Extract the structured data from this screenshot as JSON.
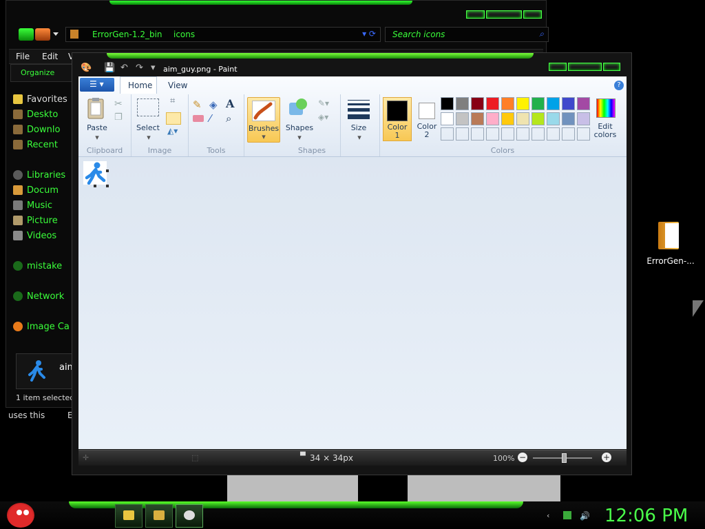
{
  "explorer": {
    "address_crumbs": [
      "ErrorGen-1.2_bin",
      "icons"
    ],
    "search_placeholder": "Search icons",
    "menu": [
      "File",
      "Edit",
      "Vi"
    ],
    "organize_label": "Organize",
    "nav_items": [
      {
        "label": "Favorites",
        "icon": "star-icon",
        "color": "#e8c640"
      },
      {
        "label": "Deskto",
        "icon": "desktop-icon",
        "color": "#8a6a3a"
      },
      {
        "label": "Downlo",
        "icon": "downloads-icon",
        "color": "#8a6a3a"
      },
      {
        "label": "Recent",
        "icon": "recent-places-icon",
        "color": "#8a6a3a"
      },
      {
        "label": "Libraries",
        "icon": "libraries-icon",
        "color": "#5a5a5a"
      },
      {
        "label": "Docum",
        "icon": "documents-icon",
        "color": "#d89a3a"
      },
      {
        "label": "Music",
        "icon": "music-icon",
        "color": "#7a7a7a"
      },
      {
        "label": "Picture",
        "icon": "pictures-icon",
        "color": "#b09a6a"
      },
      {
        "label": "Videos",
        "icon": "videos-icon",
        "color": "#8a8a8a"
      },
      {
        "label": "mistake",
        "icon": "homegroup-icon",
        "color": "#1a6a1a"
      },
      {
        "label": "Network",
        "icon": "network-icon",
        "color": "#1a6a1a"
      },
      {
        "label": "Image Ca",
        "icon": "image-capture-icon",
        "color": "#e87a1a"
      }
    ],
    "detail_name": "aim_",
    "status": "1 item selected",
    "below_text_a": "uses this",
    "below_text_b": "E"
  },
  "paint": {
    "title": "aim_guy.png - Paint",
    "tabs": {
      "home": "Home",
      "view": "View"
    },
    "help": "?",
    "groups": {
      "clipboard": "Clipboard",
      "image": "Image",
      "tools": "Tools",
      "shapes": "Shapes",
      "colors": "Colors"
    },
    "buttons": {
      "paste": "Paste",
      "select": "Select",
      "brushes": "Brushes",
      "shapes": "Shapes",
      "size": "Size",
      "color1": "Color\n1",
      "color1_a": "Color",
      "color1_b": "1",
      "color2_a": "Color",
      "color2_b": "2",
      "edit_colors_a": "Edit",
      "edit_colors_b": "colors"
    },
    "palette_row1": [
      "#000000",
      "#7f7f7f",
      "#880015",
      "#ed1c24",
      "#ff7f27",
      "#fff200",
      "#22b14c",
      "#00a2e8",
      "#3f48cc",
      "#a349a4"
    ],
    "palette_row2": [
      "#ffffff",
      "#c3c3c3",
      "#b97a57",
      "#ffaec9",
      "#ffc90e",
      "#efe4b0",
      "#b5e61d",
      "#99d9ea",
      "#7092be",
      "#c8bfe7"
    ],
    "color1_value": "#000000",
    "color2_value": "#ffffff",
    "status_dimensions": "34 × 34px",
    "zoom": "100%"
  },
  "desktop": {
    "icon_label": "ErrorGen-..."
  },
  "taskbar": {
    "clock": "12:06 PM"
  }
}
